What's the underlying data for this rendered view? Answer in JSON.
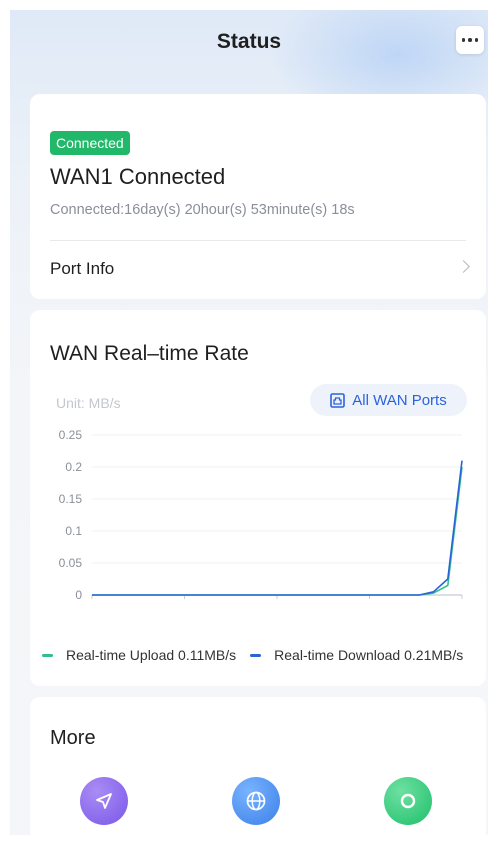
{
  "header": {
    "title": "Status",
    "more_icon": "ellipsis-icon"
  },
  "wan_card": {
    "badge": "Connected",
    "title": "WAN1 Connected",
    "duration": "Connected:16day(s) 20hour(s) 53minute(s) 18s",
    "port_info_label": "Port Info"
  },
  "rate_card": {
    "title": "WAN Real–time Rate",
    "unit": "Unit: MB/s",
    "ports_button": "All WAN Ports",
    "legend": {
      "upload": "Real-time Upload 0.11MB/s",
      "download": "Real-time Download 0.21MB/s"
    }
  },
  "chart_data": {
    "type": "line",
    "ylabel": "Unit: MB/s",
    "ylim": [
      0,
      0.25
    ],
    "yticks": [
      "0.25",
      "0.2",
      "0.15",
      "0.1",
      "0.05",
      "0"
    ],
    "grid": true,
    "legend_position": "bottom",
    "series": [
      {
        "name": "Real-time Upload",
        "color": "#2fbf8f",
        "values": [
          0,
          0,
          0,
          0,
          0,
          0,
          0,
          0,
          0,
          0,
          0,
          0,
          0,
          0,
          0,
          0,
          0,
          0,
          0,
          0,
          0,
          0,
          0,
          0,
          0.003,
          0.015,
          0.2
        ]
      },
      {
        "name": "Real-time Download",
        "color": "#2b63d9",
        "values": [
          0,
          0,
          0,
          0,
          0,
          0,
          0,
          0,
          0,
          0,
          0,
          0,
          0,
          0,
          0,
          0,
          0,
          0,
          0,
          0,
          0,
          0,
          0,
          0,
          0.005,
          0.025,
          0.21
        ]
      }
    ]
  },
  "more_card": {
    "title": "More",
    "icons": [
      "send-icon",
      "globe-icon",
      "circle-icon"
    ]
  },
  "colors": {
    "accent": "#2b63d9",
    "success": "#21b86a",
    "upload": "#2fbf8f",
    "download": "#2b63d9"
  }
}
